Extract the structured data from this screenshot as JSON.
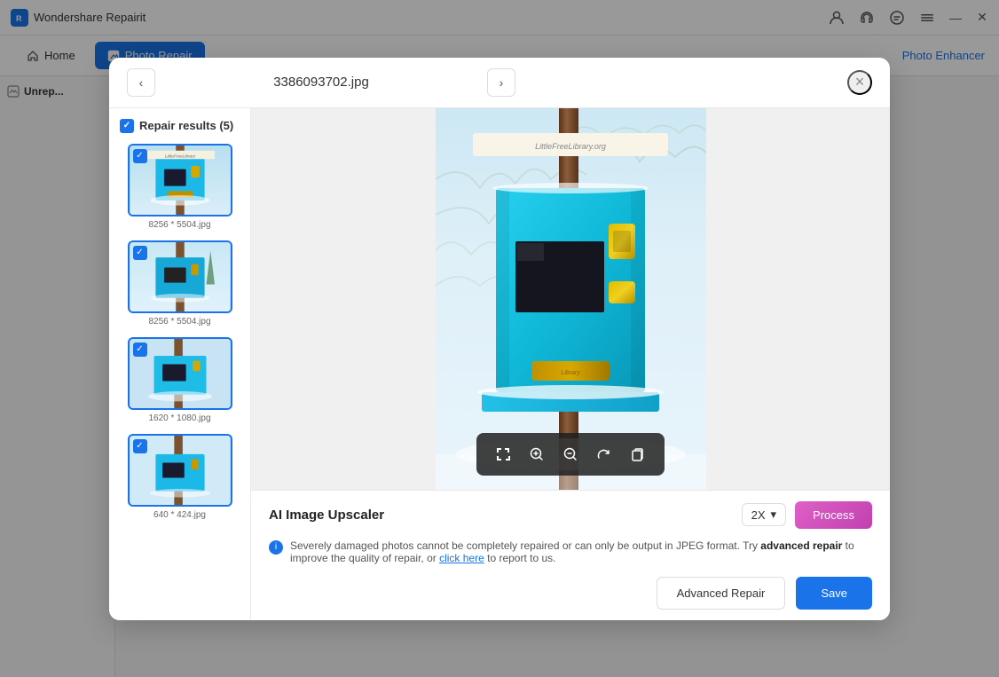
{
  "app": {
    "title": "Wondershare Repairit",
    "icon_char": "R"
  },
  "titlebar": {
    "controls": [
      "account-icon",
      "headset-icon",
      "message-icon",
      "menu-icon",
      "minimize-icon",
      "close-icon"
    ]
  },
  "navbar": {
    "home_label": "Home",
    "active_tab_label": "Photo Repair",
    "photo_enhancer_label": "Photo Enhancer"
  },
  "background": {
    "section_title": "Unrep..."
  },
  "modal": {
    "prev_label": "‹",
    "next_label": "›",
    "filename": "3386093702.jpg",
    "close_label": "×",
    "sidebar_header": "Repair results (5)",
    "thumbnails": [
      {
        "label": "8256 * 5504.jpg",
        "selected": true,
        "is_first": true
      },
      {
        "label": "8256 * 5504.jpg",
        "selected": true
      },
      {
        "label": "1620 * 1080.jpg",
        "selected": true
      },
      {
        "label": "640 * 424.jpg",
        "selected": true
      }
    ],
    "image_toolbar": {
      "fullscreen": "⛶",
      "zoom_in": "⊕",
      "zoom_out": "⊖",
      "rotate": "↻",
      "copy": "⎘"
    },
    "footer": {
      "ai_label": "AI Image Upscaler",
      "scale_value": "2X",
      "scale_chevron": "▾",
      "process_label": "Process",
      "info_text_before": "Severely damaged photos cannot be completely repaired or can only be output in JPEG format. Try ",
      "info_bold": "advanced repair",
      "info_text_middle": " to improve the quality of repair, or ",
      "info_link": "click here",
      "info_text_after": " to report to us.",
      "advanced_repair_label": "Advanced Repair",
      "save_label": "Save"
    }
  }
}
